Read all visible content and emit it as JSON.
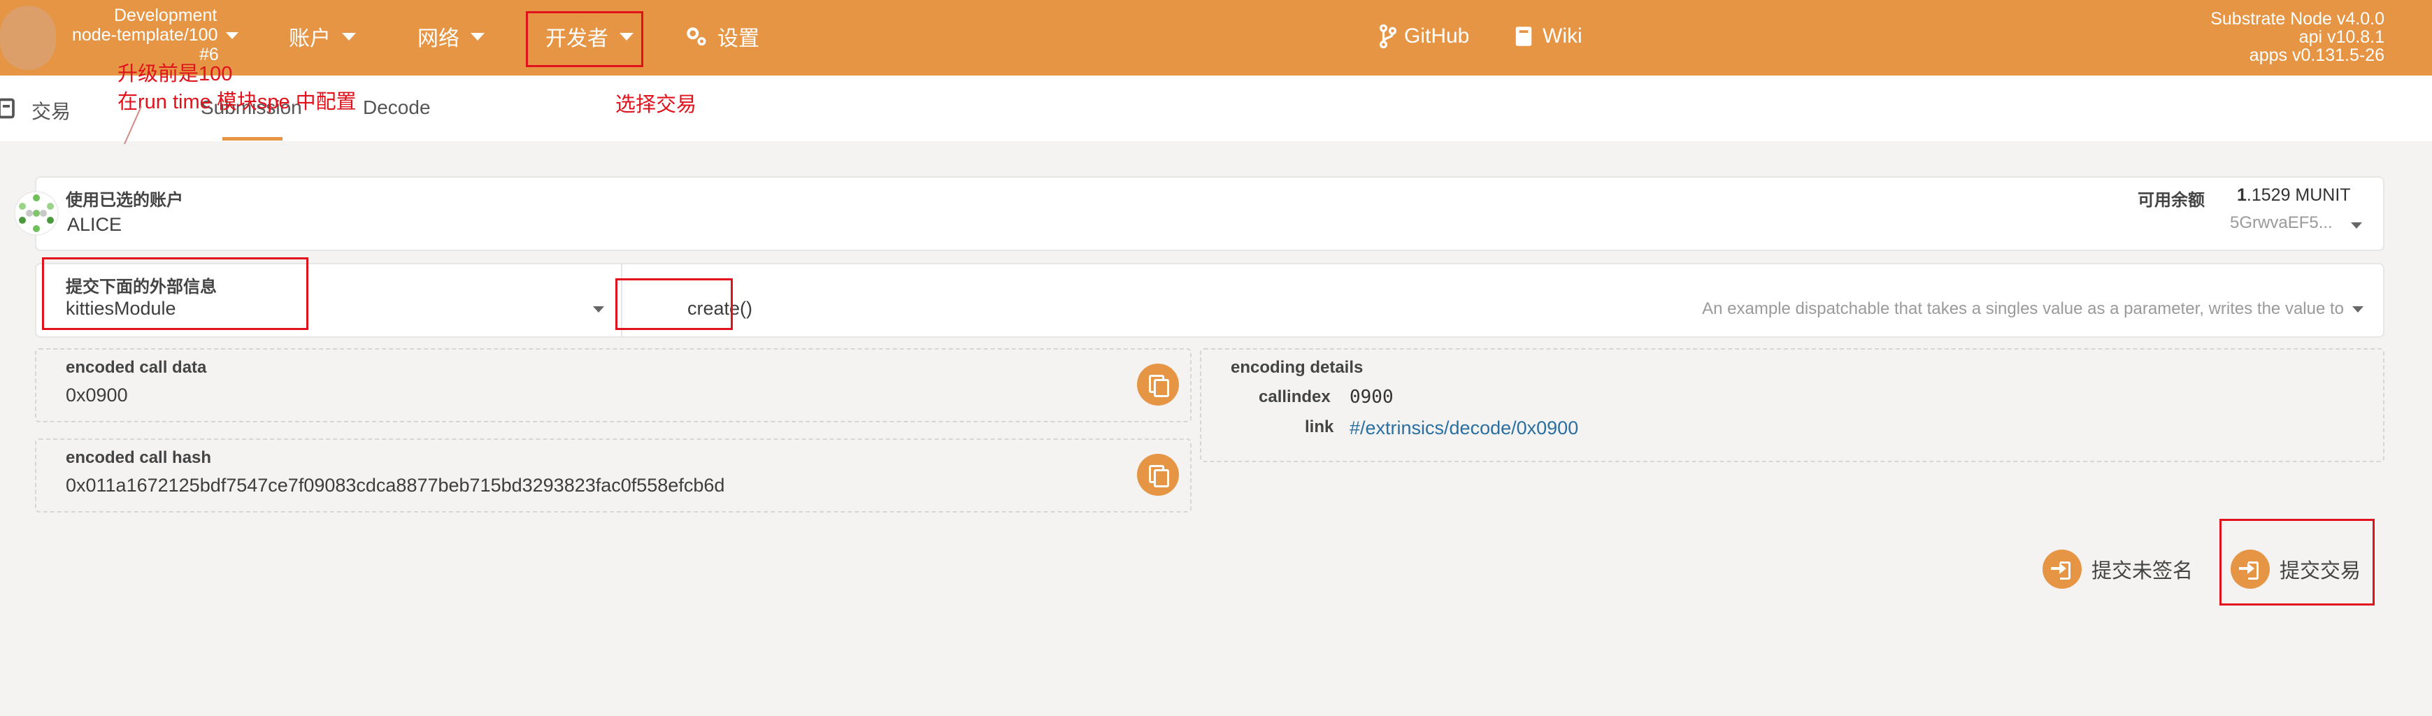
{
  "header": {
    "chain_name": "Development",
    "runtime": "node-template/100",
    "block": "#6",
    "menu": [
      "账户",
      "网络",
      "开发者",
      "设置"
    ],
    "links": [
      "GitHub",
      "Wiki"
    ],
    "versions": [
      "Substrate Node v4.0.0",
      "api v10.8.1",
      "apps v0.131.5-26"
    ]
  },
  "tabs": {
    "section": "交易",
    "items": [
      "Submission",
      "Decode"
    ],
    "active": "Submission"
  },
  "account": {
    "label": "使用已选的账户",
    "name": "ALICE",
    "balance_label": "可用余额",
    "balance_int": "1",
    "balance_rest": ".1529 MUNIT",
    "address": "5GrwvaEF5..."
  },
  "extrinsic": {
    "label": "提交下面的外部信息",
    "module": "kittiesModule",
    "method": "create()",
    "description": "An example dispatchable that takes a singles value as a parameter, writes the value to"
  },
  "call_data": {
    "label": "encoded call data",
    "value": "0x0900"
  },
  "call_hash": {
    "label": "encoded call hash",
    "value": "0x011a1672125bdf7547ce7f09083cdca8877beb715bd3293823fac0f558efcb6d"
  },
  "encoding": {
    "label": "encoding details",
    "callindex_label": "callindex",
    "callindex_value": "0900",
    "link_label": "link",
    "link_value": "#/extrinsics/decode/0x0900"
  },
  "actions": {
    "unsigned": "提交未签名",
    "submit": "提交交易"
  },
  "annotations": {
    "note_line1": "升级前是100",
    "note_line2": "在run time 模块spe 中配置",
    "choose_tx": "选择交易"
  },
  "colors": {
    "accent": "#e69545",
    "annotation": "#e0121b",
    "link": "#2a6fa0"
  }
}
